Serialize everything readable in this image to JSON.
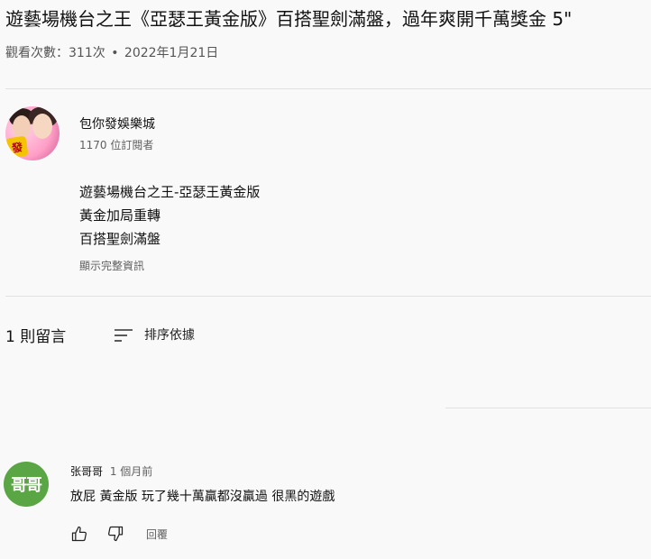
{
  "video": {
    "title": "遊藝場機台之王《亞瑟王黃金版》百搭聖劍滿盤，過年爽開千萬獎金 5\"",
    "views": "觀看次數：311次",
    "separator": "•",
    "date": "2022年1月21日"
  },
  "channel": {
    "name": "包你發娛樂城",
    "subscribers": "1170 位訂閱者",
    "avatar_badge": "發"
  },
  "description": {
    "lines": [
      "遊藝場機台之王-亞瑟王黃金版",
      "黃金加局重轉",
      "百搭聖劍滿盤"
    ],
    "show_more": "顯示完整資訊"
  },
  "comments": {
    "count_label": "1 則留言",
    "sort_label": "排序依據",
    "items": [
      {
        "avatar_text": "哥哥",
        "avatar_color": "#5aa544",
        "author": "张哥哥",
        "time": "1 個月前",
        "text": "放屁 黃金版 玩了幾十萬贏都沒贏過  很黑的遊戲",
        "reply_label": "回覆"
      }
    ]
  },
  "icons": {
    "sort": "sort-icon",
    "like": "thumb-up-icon",
    "dislike": "thumb-down-icon"
  }
}
